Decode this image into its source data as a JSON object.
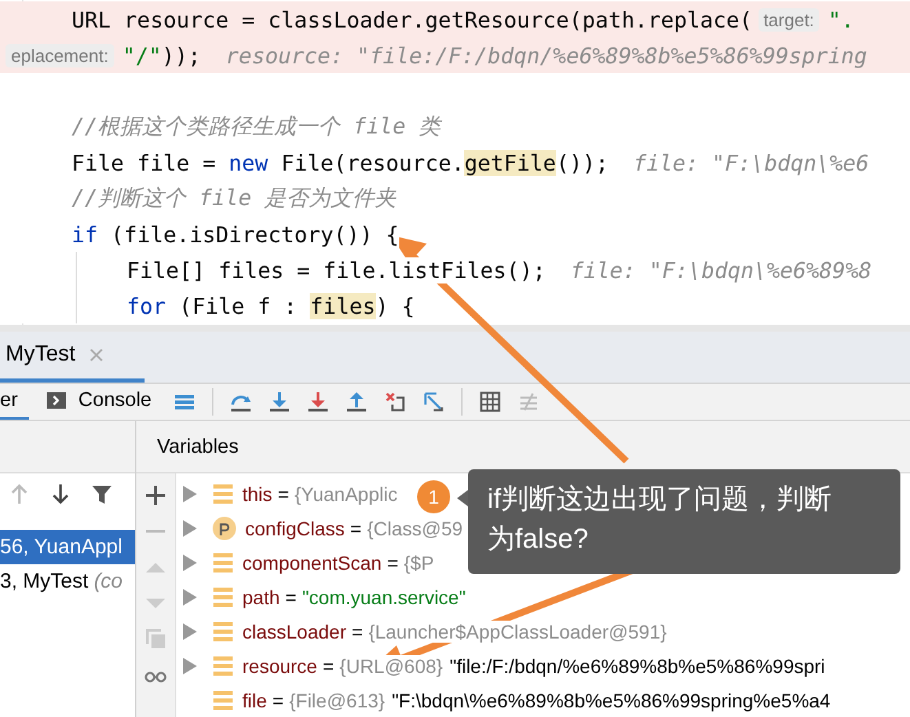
{
  "editor": {
    "lines": [
      {
        "execution": true,
        "kind": "statement",
        "segments": [
          {
            "kind": "code",
            "text": "URL resource = classLoader.getResource(path.replace("
          },
          {
            "kind": "param",
            "text": "target:"
          },
          {
            "kind": "string",
            "text": "\"."
          }
        ]
      },
      {
        "execution": true,
        "kind": "wrap",
        "segments": [
          {
            "kind": "param",
            "text": "eplacement:"
          },
          {
            "kind": "string",
            "text": "\"/\""
          },
          {
            "kind": "code",
            "text": "));"
          },
          {
            "kind": "hint",
            "text": "resource: \"file:/F:/bdqn/%e6%89%8b%e5%86%99spring"
          }
        ]
      },
      {
        "execution": false,
        "kind": "blank"
      },
      {
        "execution": false,
        "kind": "statement",
        "segments": [
          {
            "kind": "comment",
            "text": "//根据这个类路径生成一个 file 类"
          }
        ]
      },
      {
        "execution": false,
        "kind": "statement",
        "segments": [
          {
            "kind": "code",
            "text": "File file = "
          },
          {
            "kind": "keyword",
            "text": "new"
          },
          {
            "kind": "code",
            "text": " File(resource."
          },
          {
            "kind": "usage",
            "text": "getFile"
          },
          {
            "kind": "code",
            "text": "());"
          },
          {
            "kind": "hint",
            "text": "file: \"F:\\bdqn\\%e6"
          }
        ]
      },
      {
        "execution": false,
        "kind": "statement",
        "segments": [
          {
            "kind": "comment",
            "text": "//判断这个 file 是否为文件夹"
          }
        ]
      },
      {
        "execution": false,
        "kind": "statement",
        "segments": [
          {
            "kind": "keyword",
            "text": "if"
          },
          {
            "kind": "code",
            "text": " (file.isDirectory()) {"
          }
        ]
      },
      {
        "execution": false,
        "kind": "body",
        "segments": [
          {
            "kind": "code",
            "text": "File[] files = file.listFiles();"
          },
          {
            "kind": "hint",
            "text": "file: \"F:\\bdqn\\%e6%89%8"
          }
        ]
      },
      {
        "execution": false,
        "kind": "body",
        "segments": [
          {
            "kind": "keyword",
            "text": "for"
          },
          {
            "kind": "code",
            "text": " (File f : "
          },
          {
            "kind": "usage",
            "text": "files"
          },
          {
            "kind": "code",
            "text": ") {"
          }
        ]
      }
    ]
  },
  "session_tab": {
    "label": "MyTest",
    "selected": true
  },
  "debug_tabs": [
    {
      "label": "er",
      "selected": true
    },
    {
      "label": "Console",
      "selected": false
    }
  ],
  "frames": [
    {
      "text": "56, YuanAppl",
      "selected": true
    },
    {
      "text": "3, MyTest",
      "note": "(co",
      "selected": false
    }
  ],
  "variables_title": "Variables",
  "variables": [
    {
      "expandable": true,
      "kind": "field",
      "name": "this",
      "sign": "=",
      "ref": "{YuanApplic"
    },
    {
      "expandable": true,
      "kind": "parameter",
      "name": "configClass",
      "sign": "=",
      "ref": "{Class@59"
    },
    {
      "expandable": true,
      "kind": "field",
      "name": "componentScan",
      "sign": "=",
      "ref": "{$P"
    },
    {
      "expandable": true,
      "kind": "field",
      "name": "path",
      "sign": "=",
      "string": "\"com.yuan.service\""
    },
    {
      "expandable": true,
      "kind": "field",
      "name": "classLoader",
      "sign": "=",
      "ref": "{Launcher$AppClassLoader@591}"
    },
    {
      "expandable": true,
      "kind": "field",
      "name": "resource",
      "sign": "=",
      "ref": "{URL@608}",
      "value": "\"file:/F:/bdqn/%e6%89%8b%e5%86%99spri"
    },
    {
      "expandable": false,
      "kind": "field",
      "name": "file",
      "sign": "=",
      "ref": "{File@613}",
      "value": "\"F:\\bdqn\\%e6%89%8b%e5%86%99spring%e5%a4"
    }
  ],
  "annotation": {
    "number": "1",
    "text": "if判断这边出现了问题，判断为false?"
  }
}
